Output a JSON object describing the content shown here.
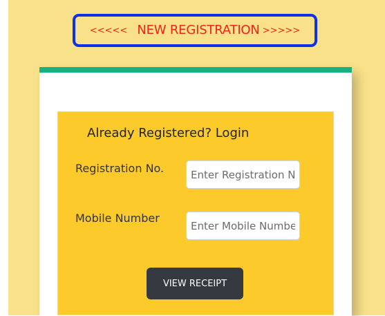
{
  "new_registration": {
    "left_arrows": "<<<<<",
    "label": "NEW REGISTRATION",
    "right_arrows": ">>>>>"
  },
  "login_form": {
    "title": "Already Registered? Login",
    "registration_label": "Registration No.",
    "registration_placeholder": "Enter Registration No.",
    "mobile_label": "Mobile Number",
    "mobile_placeholder": "Enter Mobile Number",
    "submit_label": "VIEW RECEIPT"
  },
  "colors": {
    "page_background": "#f9e18a",
    "highlight_border": "#1030e8",
    "link_text": "#e8261c",
    "card_top_border": "#17b27d",
    "panel_background": "#fdca2b",
    "button_background": "#343a40"
  }
}
